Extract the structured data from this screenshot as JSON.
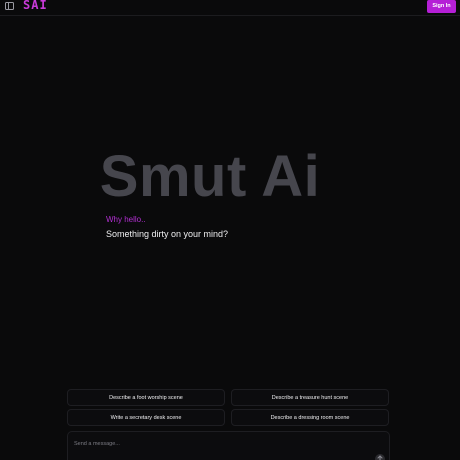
{
  "header": {
    "logo_text": "SAI",
    "signin_label": "Sign In",
    "accent_color": "#b51fd6"
  },
  "hero": {
    "title": "Smut Ai",
    "greeting": "Why hello..",
    "subtitle": "Something dirty on your mind?"
  },
  "suggestions": [
    {
      "label": "Describe a foot worship scene"
    },
    {
      "label": "Describe a treasure hunt scene"
    },
    {
      "label": "Write a secretary desk scene"
    },
    {
      "label": "Describe a dressing room scene"
    }
  ],
  "composer": {
    "placeholder": "Send a message...",
    "send_icon": "arrow-up-icon"
  },
  "icons": {
    "sidebar_toggle": "sidebar-toggle-icon"
  }
}
